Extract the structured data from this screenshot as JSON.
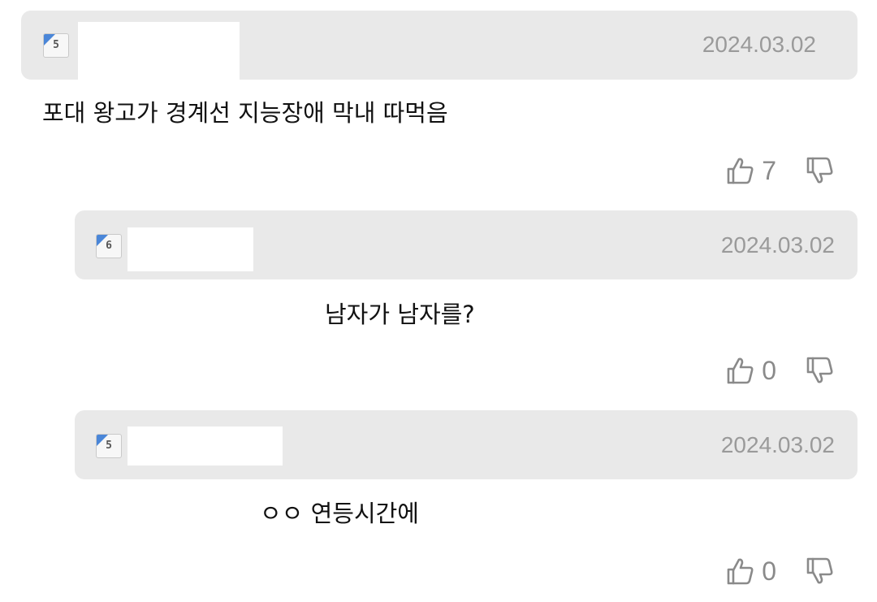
{
  "comments": [
    {
      "level": "5",
      "date": "2024.03.02",
      "text": "포대 왕고가 경계선 지능장애 막내 따먹음",
      "likes": "7"
    },
    {
      "level": "6",
      "date": "2024.03.02",
      "text": "남자가 남자를?",
      "likes": "0"
    },
    {
      "level": "5",
      "date": "2024.03.02",
      "text": "ㅇㅇ 연등시간에",
      "likes": "0"
    }
  ],
  "icons": {
    "like": "thumbs-up-icon",
    "dislike": "thumbs-down-icon"
  },
  "colors": {
    "header_bg": "#e9e9e9",
    "date": "#9a9a9a",
    "badge_accent": "#4a86d8",
    "vote_count": "#8a8a8a"
  }
}
